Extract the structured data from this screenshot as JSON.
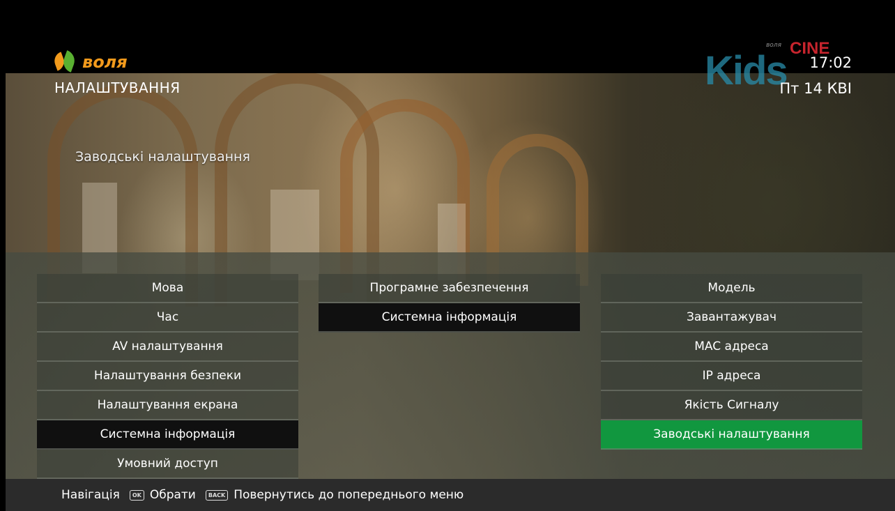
{
  "header": {
    "brand": "воля",
    "page_title": "НАЛАШТУВАННЯ",
    "time": "17:02",
    "date": "Пт 14 КВІ",
    "channel_logo": {
      "main": "Kids",
      "cine": "CINE",
      "tiny": "воля"
    }
  },
  "subtitle": "Заводські налаштування",
  "menu": {
    "col1": [
      "Мова",
      "Час",
      "AV налаштування",
      "Налаштування безпеки",
      "Налаштування екрана",
      "Системна інформація",
      "Умовний доступ"
    ],
    "col2": [
      "Програмне забезпечення",
      "Системна інформація"
    ],
    "col3": [
      "Модель",
      "Завантажувач",
      "MAC адреса",
      "IP адреса",
      "Якість Сигналу",
      "Заводські налаштування"
    ]
  },
  "footer": {
    "nav_label": "Навігація",
    "ok_key": "OK",
    "select_label": "Обрати",
    "back_key": "BACK",
    "back_label": "Повернутись до попереднього меню"
  },
  "colors": {
    "accent_green": "#11973f",
    "brand_orange": "#f29a1c"
  }
}
